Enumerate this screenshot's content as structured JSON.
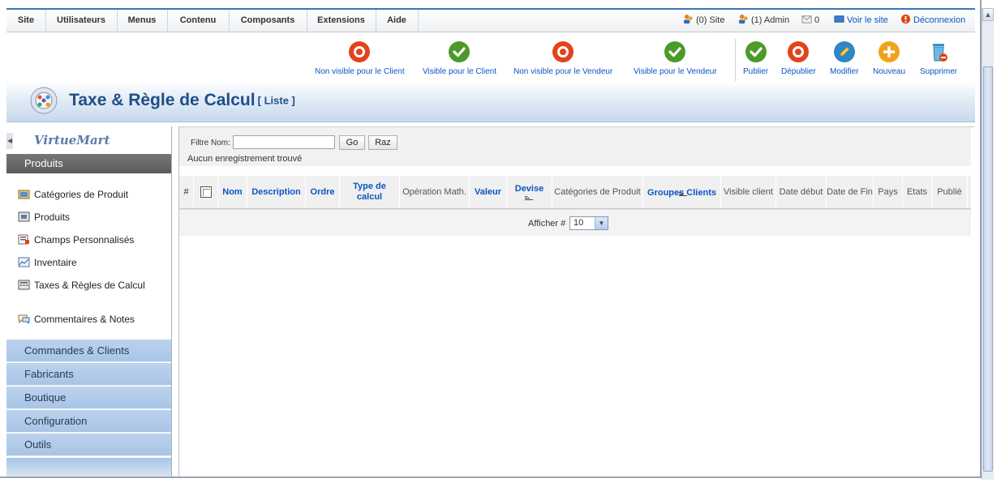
{
  "menu": {
    "items": [
      "Site",
      "Utilisateurs",
      "Menus",
      "Contenu",
      "Composants",
      "Extensions",
      "Aide"
    ],
    "status": {
      "site": "(0) Site",
      "admin": "(1) Admin",
      "messages": "0",
      "view_site": "Voir le site",
      "logout": "Déconnexion"
    }
  },
  "toolbar": {
    "buttons": [
      {
        "label": "Non visible pour le Client",
        "icon": "red-x-icon"
      },
      {
        "label": "Visible pour le Client",
        "icon": "green-check-icon"
      },
      {
        "label": "Non visible pour le Vendeur",
        "icon": "red-x-icon"
      },
      {
        "label": "Visible pour le Vendeur",
        "icon": "green-check-icon"
      },
      {
        "label": "Publier",
        "icon": "green-check-icon"
      },
      {
        "label": "Dépublier",
        "icon": "red-x-icon"
      },
      {
        "label": "Modifier",
        "icon": "pencil-icon"
      },
      {
        "label": "Nouveau",
        "icon": "plus-icon"
      },
      {
        "label": "Supprimer",
        "icon": "trash-icon"
      }
    ]
  },
  "page": {
    "title": "Taxe & Règle de Calcul",
    "subtitle": "[ Liste ]"
  },
  "sidebar": {
    "logo": "VirtueMart",
    "active_section": "Produits",
    "links": [
      {
        "label": "Catégories de Produit",
        "icon": "category-icon"
      },
      {
        "label": "Produits",
        "icon": "product-icon"
      },
      {
        "label": "Champs Personnalisés",
        "icon": "custom-fields-icon"
      },
      {
        "label": "Inventaire",
        "icon": "inventory-icon"
      },
      {
        "label": "Taxes & Règles de Calcul",
        "icon": "tax-calculator-icon"
      },
      {
        "label": "Commentaires & Notes",
        "icon": "comments-icon"
      }
    ],
    "sections": [
      "Commandes & Clients",
      "Fabricants",
      "Boutique",
      "Configuration",
      "Outils"
    ]
  },
  "filter": {
    "label": "Filtre Nom:",
    "value": "",
    "go": "Go",
    "reset": "Raz",
    "no_records": "Aucun enregistrement trouvé"
  },
  "grid": {
    "columns": [
      "#",
      "Nom",
      "Description",
      "Ordre",
      "Type de calcul",
      "Opération Math.",
      "Valeur",
      "Devise",
      "Catégories de Produit",
      "Groupes Clients",
      "Visible client",
      "Date début",
      "Date de Fin",
      "Pays",
      "Etats",
      "Publié"
    ],
    "display_label": "Afficher #",
    "page_size": "10"
  },
  "colors": {
    "accent": "#3a76b3",
    "link": "#0b55c4",
    "title": "#1f4e8a",
    "sidebar_section": "#bcd3ee"
  }
}
